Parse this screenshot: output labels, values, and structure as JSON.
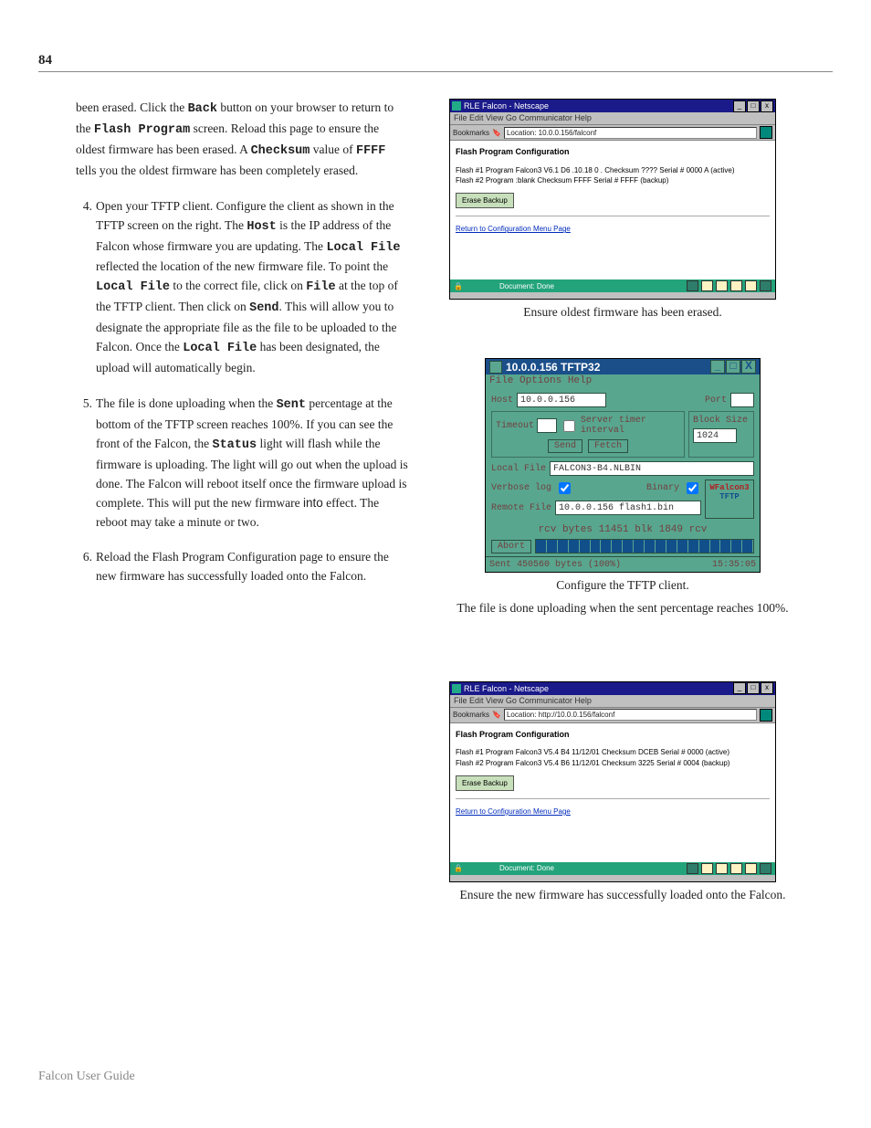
{
  "page_number": "84",
  "footer": "Falcon User Guide",
  "intro_para": {
    "t1": "been erased.  Click the ",
    "b1": "Back",
    "t2": " button on your browser to return to the ",
    "b2": "Flash Program",
    "t3": " screen.  Reload this page to ensure the oldest firmware has been erased.  A ",
    "b3": "Checksum",
    "t4": " value of ",
    "b4": "FFFF",
    "t5": " tells you the oldest firmware has been completely erased."
  },
  "step4": {
    "num": "4.",
    "t1": "Open your TFTP client.  Configure the client as shown in the TFTP screen on the right.  The ",
    "b1": "Host",
    "t2": " is the IP address of the Falcon whose firmware you are updating.  The ",
    "b2": "Local File",
    "t3": " reflected the location of the new firmware file.  To point the ",
    "b3": "Local File",
    "t4": " to the correct file, click on ",
    "b4": "File",
    "t5": " at the top of the TFTP client.  Then click on ",
    "b5": "Send",
    "t6": ".  This will allow you to designate the appropriate file as the file to be uploaded to the Falcon.  Once the ",
    "b6": "Local File",
    "t7": " has been designated, the upload will automatically begin."
  },
  "step5": {
    "num": "5.",
    "t1": "The file is done uploading when the ",
    "b1": "Sent",
    "t2": " percentage at the bottom of the TFTP screen reaches 100%.  If you can see the front of the Falcon, the ",
    "b2": "Status",
    "t3": " light will flash while the firmware is uploading.  The light will go out when the upload is done.  The Falcon will reboot itself once the firmware upload is complete.  This will put the new firmware ",
    "sans": "into",
    "t4": " effect.  The reboot may take a minute or two."
  },
  "step6": {
    "num": "6.",
    "t1": "Reload the Flash Program Configuration page to ensure the new firmware has successfully loaded onto the Falcon."
  },
  "caption1": "Ensure oldest firmware has been erased.",
  "caption2a": "Configure the TFTP client.",
  "caption2b": "The file is done uploading when the sent percentage reaches 100%.",
  "caption3": "Ensure the new firmware has successfully loaded onto the Falcon.",
  "ns1": {
    "title": "RLE Falcon - Netscape",
    "menu": "File   Edit   View   Go   Communicator   Help",
    "loc_label": "Bookmarks",
    "location": "Location: 10.0.0.156/falconf",
    "heading": "Flash Program Configuration",
    "line1": "Flash #1 Program   Falcon3 V6.1 D6 .10.18 0 . Checksum  ????  Serial #  0000 A  (active)",
    "line2": "Flash #2 Program   :blank                          Checksum  FFFF  Serial #  FFFF  (backup)",
    "button": "Erase Backup",
    "link": "Return to Configuration Menu Page",
    "status": "Document: Done"
  },
  "tftp": {
    "title": "10.0.0.156   TFTP32",
    "menu": "File   Options   Help",
    "host_lbl": "Host",
    "host_val": "10.0.0.156",
    "port_lbl": "Port",
    "timeout_lbl": "Timeout",
    "srvtimer_lbl": "Server timer interval",
    "blk_lbl": "Block Size",
    "send_btn": "Send",
    "fetch_btn": "Fetch",
    "size_val": "1024",
    "localfile_lbl": "Local File",
    "localfile_val": "FALCON3-B4.NLBIN",
    "verbose_lbl": "Verbose log",
    "binary_lbl": "Binary",
    "logo_top": "WFalcon3",
    "logo_bot": "TFTP",
    "remote_lbl": "Remote File",
    "remote_val": "10.0.0.156   flash1.bin",
    "pkt_line": "rcv  bytes   11451    blk    1849   rcv",
    "abort_btn": "Abort",
    "status": "Sent 450560 bytes (100%)",
    "status_r": "15:35:05"
  },
  "ns2": {
    "title": "RLE Falcon - Netscape",
    "menu": "File   Edit   View   Go   Communicator   Help",
    "loc_label": "Bookmarks",
    "location": "Location: http://10.0.0.156/falconf",
    "heading": "Flash Program Configuration",
    "line1": "Flash #1 Program  Falcon3 V5.4 B4 11/12/01 Checksum  DCEB Serial #  0000  (active)",
    "line2": "Flash #2 Program  Falcon3 V5.4 B6 11/12/01 Checksum  3225  Serial #  0004  (backup)",
    "button": "Erase Backup",
    "link": "Return to Configuration Menu Page",
    "status": "Document: Done"
  }
}
